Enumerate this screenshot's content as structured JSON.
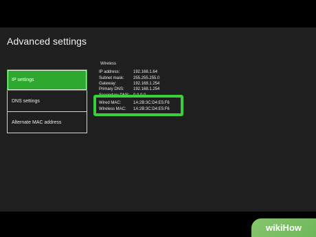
{
  "header": {
    "title": "Advanced settings"
  },
  "menu": {
    "items": [
      {
        "label": "IP settings",
        "selected": true
      },
      {
        "label": "DNS settings",
        "selected": false
      },
      {
        "label": "Alternate MAC address",
        "selected": false
      }
    ]
  },
  "details": {
    "section": "Wireless",
    "rows": [
      {
        "label": "IP address:",
        "value": "192.168.1.64"
      },
      {
        "label": "Subnet mask:",
        "value": "255.255.255.0"
      },
      {
        "label": "Gateway:",
        "value": "192.168.1.254"
      },
      {
        "label": "Primary DNS:",
        "value": "192.168.1.254"
      },
      {
        "label": "Secondary DNS:",
        "value": "0.0.0.0"
      }
    ],
    "mac_rows": [
      {
        "label": "Wired MAC:",
        "value": "1A:2B:3C:D4:E5:F6"
      },
      {
        "label": "Wireless MAC:",
        "value": "1A:2B:3C:D4:E5:F6"
      }
    ]
  },
  "watermark": {
    "text": "wikiHow"
  },
  "colors": {
    "accent": "#2fa82f",
    "highlight": "#39d13a",
    "background": "#1f1f1f"
  }
}
